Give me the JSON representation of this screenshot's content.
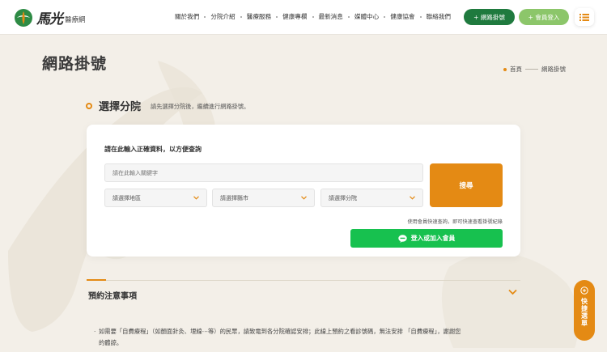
{
  "logo": {
    "name": "馬光",
    "suffix": "醫療網"
  },
  "nav": {
    "items": [
      "關於我們",
      "分院介紹",
      "醫療服務",
      "健康專欄",
      "最新消息",
      "媒體中心",
      "健康協會",
      "聯絡我們"
    ],
    "booking_button": "+ 網路掛號",
    "member_button": "+ 會員登入"
  },
  "page": {
    "title": "網路掛號"
  },
  "breadcrumb": {
    "home": "首頁",
    "current": "網路掛號"
  },
  "section": {
    "title": "選擇分院",
    "desc": "請先選擇分院後，繼續進行網路掛號。"
  },
  "form": {
    "heading": "請在此輸入正確資料，以方便查詢",
    "keyword_placeholder": "請在此輸入關鍵字",
    "region_select": "請選擇地區",
    "city_select": "請選擇縣市",
    "branch_select": "請選擇分院",
    "search_button": "搜尋",
    "member_note": "使用會員快速查詢，即可快速查看掛號紀錄",
    "line_button": "登入或加入會員"
  },
  "notice": {
    "title": "預約注意事項",
    "line1": "如需要「自費療程」（如顏面針灸、埋線⋯等）的民眾，請致電到各分院確認安排；此線上預約之看診號碼，無法安排 「自費療程」，謝謝您",
    "line2": "的體諒。"
  },
  "quick_menu": {
    "label": "快捷選單"
  },
  "colors": {
    "orange": "#e48a14",
    "green": "#1f7a3e",
    "light_green": "#8cc66a",
    "line_green": "#17c14f"
  }
}
